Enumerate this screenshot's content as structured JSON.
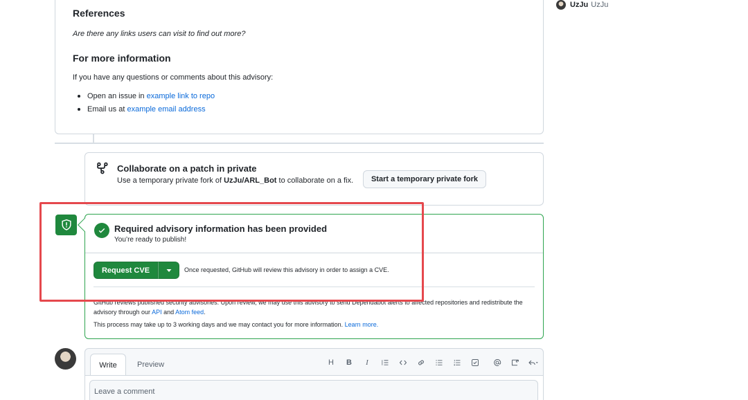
{
  "advisory": {
    "references_heading": "References",
    "references_text": "Are there any links users can visit to find out more?",
    "more_info_heading": "For more information",
    "more_info_text": "If you have any questions or comments about this advisory:",
    "list": [
      {
        "prefix": "Open an issue in ",
        "link": "example link to repo"
      },
      {
        "prefix": "Email us at ",
        "link": "example email address"
      }
    ]
  },
  "collaborate": {
    "title": "Collaborate on a patch in private",
    "desc_prefix": "Use a temporary private fork of ",
    "repo": "UzJu/ARL_Bot",
    "desc_suffix": " to collaborate on a fix.",
    "button": "Start a temporary private fork"
  },
  "required": {
    "title": "Required advisory information has been provided",
    "subtitle": "You’re ready to publish!",
    "cve_button": "Request CVE",
    "cve_note": "Once requested, GitHub will review this advisory in order to assign a CVE.",
    "fine_print_1_a": "GitHub reviews published security advisories. Upon review, we may use this advisory to send Dependabot alerts to affected repositories and redistribute the advisory through our ",
    "fine_print_1_api": "API",
    "fine_print_1_b": " and ",
    "fine_print_1_feed": "Atom feed",
    "fine_print_1_c": ".",
    "fine_print_2_a": "This process may take up to 3 working days and we may contact you for more information. ",
    "fine_print_2_link": "Learn more."
  },
  "composer": {
    "tab_write": "Write",
    "tab_preview": "Preview",
    "placeholder": "Leave a comment",
    "toolbar": [
      "H",
      "B",
      "I"
    ]
  },
  "participant": {
    "login": "UzJu",
    "name": "UzJu"
  },
  "colors": {
    "accent_green": "#1f883d",
    "link_blue": "#0969da",
    "highlight_red": "#e5484d"
  }
}
